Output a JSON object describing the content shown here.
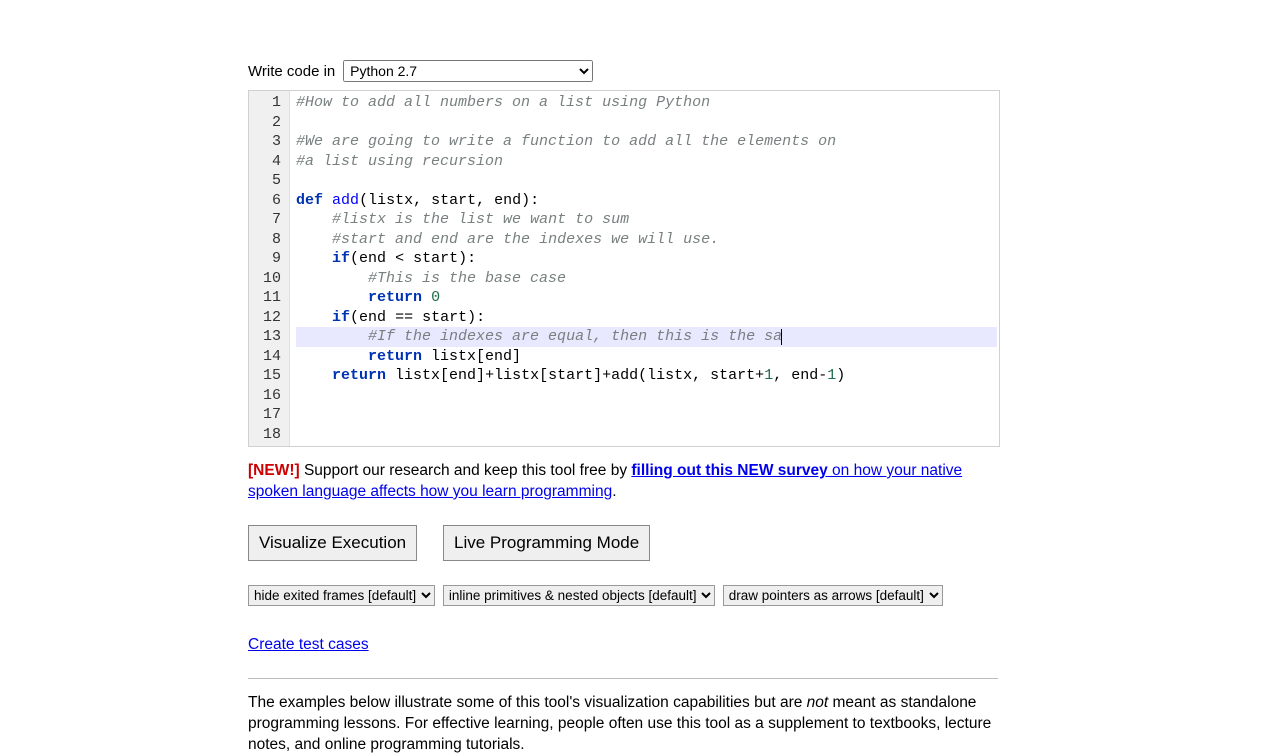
{
  "lang_label": "Write code in",
  "lang_selected": "Python 2.7",
  "code_lines": [
    {
      "n": 1,
      "raw": "#How to add all numbers on a list using Python",
      "type": "comment"
    },
    {
      "n": 2,
      "raw": "",
      "type": "blank"
    },
    {
      "n": 3,
      "raw": "#We are going to write a function to add all the elements on",
      "type": "comment"
    },
    {
      "n": 4,
      "raw": "#a list using recursion",
      "type": "comment"
    },
    {
      "n": 5,
      "raw": "",
      "type": "blank"
    },
    {
      "n": 6,
      "raw": "def add(listx, start, end):",
      "type": "def"
    },
    {
      "n": 7,
      "raw": "    #listx is the list we want to sum",
      "type": "comment-indent1"
    },
    {
      "n": 8,
      "raw": "    #start and end are the indexes we will use.",
      "type": "comment-indent1"
    },
    {
      "n": 9,
      "raw": "    if(end < start):",
      "type": "if1"
    },
    {
      "n": 10,
      "raw": "        #This is the base case",
      "type": "comment-indent2"
    },
    {
      "n": 11,
      "raw": "        return 0",
      "type": "return0"
    },
    {
      "n": 12,
      "raw": "    if(end == start):",
      "type": "if2"
    },
    {
      "n": 13,
      "raw": "        #If the indexes are equal, then this is the sa",
      "type": "comment-active"
    },
    {
      "n": 14,
      "raw": "        return listx[end]",
      "type": "return-listx"
    },
    {
      "n": 15,
      "raw": "    return listx[end]+listx[start]+add(listx, start+1, end-1)",
      "type": "return-big"
    },
    {
      "n": 16,
      "raw": "",
      "type": "blank"
    },
    {
      "n": 17,
      "raw": "",
      "type": "blank"
    },
    {
      "n": 18,
      "raw": "",
      "type": "blank"
    }
  ],
  "survey": {
    "new_badge": "[NEW!]",
    "text_before": " Support our research and keep this tool free by ",
    "link_text": "filling out this NEW survey",
    "text_mid": " on how your native spoken language affects how you learn programming",
    "text_after": "."
  },
  "buttons": {
    "visualize": "Visualize Execution",
    "live": "Live Programming Mode"
  },
  "options": {
    "frames": "hide exited frames [default]",
    "primitives": "inline primitives & nested objects [default]",
    "pointers": "draw pointers as arrows [default]"
  },
  "create_link": "Create test cases",
  "footer": {
    "part1": "The examples below illustrate some of this tool's visualization capabilities but are ",
    "not": "not",
    "part2": " meant as standalone programming lessons. For effective learning, people often use this tool as a supplement to textbooks, lecture notes, and online programming tutorials."
  }
}
